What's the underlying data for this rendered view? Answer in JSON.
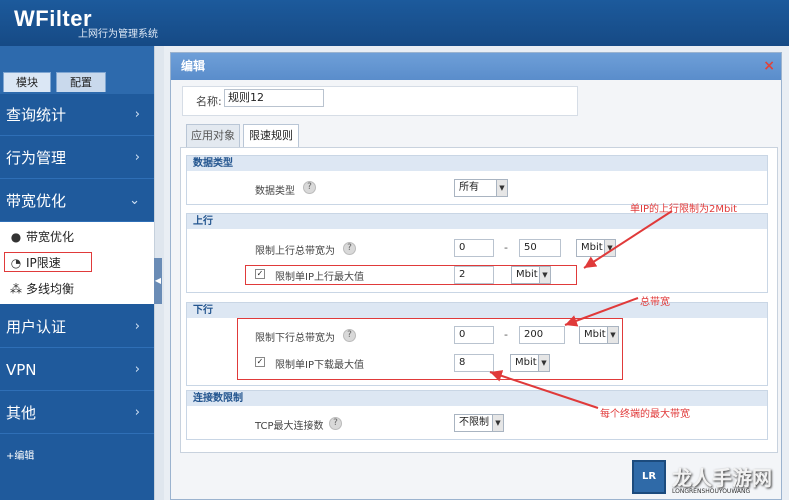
{
  "app": {
    "brand": "WFilter",
    "subtitle": "上网行为管理系统"
  },
  "sidebar": {
    "tabs": [
      "模块",
      "配置"
    ],
    "menu": [
      {
        "label": "查询统计",
        "chevron": "›"
      },
      {
        "label": "行为管理",
        "chevron": "›"
      },
      {
        "label": "带宽优化",
        "chevron": "⌄"
      },
      {
        "label": "用户认证",
        "chevron": "›"
      },
      {
        "label": "VPN",
        "chevron": "›"
      },
      {
        "label": "其他",
        "chevron": "›"
      }
    ],
    "submenu": [
      {
        "label": "带宽优化",
        "icon": "circle-icon"
      },
      {
        "label": "IP限速",
        "icon": "gauge-icon"
      },
      {
        "label": "多线均衡",
        "icon": "network-icon"
      }
    ],
    "edit_link": "+编辑"
  },
  "dialog": {
    "title": "编辑",
    "close": "×",
    "name_label": "名称:",
    "name_value": "规则12",
    "tabs": [
      "应用对象",
      "限速规则"
    ],
    "sections": {
      "data_type": {
        "title": "数据类型",
        "label": "数据类型",
        "value": "所有"
      },
      "upload": {
        "title": "上行",
        "total_label": "限制上行总带宽为",
        "total_min": "0",
        "total_max": "50",
        "total_unit": "Mbit",
        "per_ip_label": "限制单IP上行最大值",
        "per_ip_value": "2",
        "per_ip_unit": "Mbit"
      },
      "download": {
        "title": "下行",
        "total_label": "限制下行总带宽为",
        "total_min": "0",
        "total_max": "200",
        "total_unit": "Mbit",
        "per_ip_label": "限制单IP下载最大值",
        "per_ip_value": "8",
        "per_ip_unit": "Mbit"
      },
      "connections": {
        "title": "连接数限制",
        "label": "TCP最大连接数",
        "value": "不限制"
      }
    },
    "help_glyph": "?",
    "dash": "-",
    "check_glyph": "✓"
  },
  "annotations": {
    "upload_note": "单IP的上行限制为2Mbit",
    "total_note": "总带宽",
    "terminal_note": "每个终端的最大带宽",
    "color": "#e03a3a"
  },
  "watermark": {
    "badge": "LR",
    "text": "龙人手游网",
    "sub": "LONGRENSHOUYOUWANG"
  }
}
